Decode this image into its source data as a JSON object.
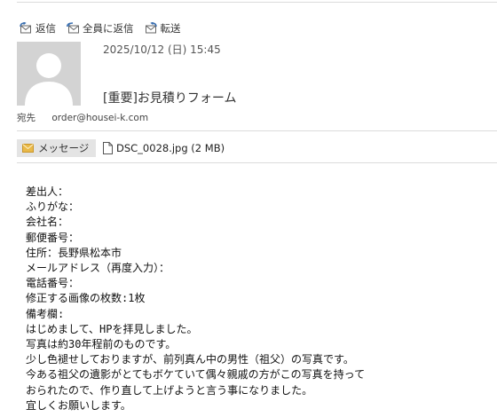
{
  "toolbar": {
    "reply": "返信",
    "reply_all": "全員に返信",
    "forward": "転送"
  },
  "header": {
    "date": "2025/10/12 (日) 15:45",
    "subject": "[重要]お見積りフォーム",
    "to_label": "宛先",
    "to_address": "order@housei-k.com"
  },
  "tabs": {
    "message": "メッセージ",
    "attachment": "DSC_0028.jpg (2 MB)"
  },
  "body": {
    "lines": [
      "差出人：",
      "ふりがな：",
      "会社名：",
      "郵便番号：",
      "住所：長野県松本市",
      "メールアドレス（再度入力）：",
      "電話番号：",
      "修正する画像の枚数:1枚",
      "備考欄:",
      "はじめまして、HPを拝見しました。",
      "写真は約30年程前のものです。",
      "少し色褪せしておりますが、前列真ん中の男性（祖父）の写真です。",
      "今ある祖父の遺影がとてもボケていて偶々親戚の方がこの写真を持って",
      "おられたので、作り直して上げようと言う事になりました。",
      "宜しくお願いします。"
    ]
  },
  "colors": {
    "divider": "#dcdcdc",
    "avatar_bg": "#d3d3d3",
    "tab_bg": "#e4e4e4",
    "envelope": "#e9b949"
  },
  "icons": {
    "reply": "reply-icon",
    "reply_all": "reply-all-icon",
    "forward": "forward-icon",
    "message": "envelope-icon",
    "attachment": "file-icon"
  }
}
